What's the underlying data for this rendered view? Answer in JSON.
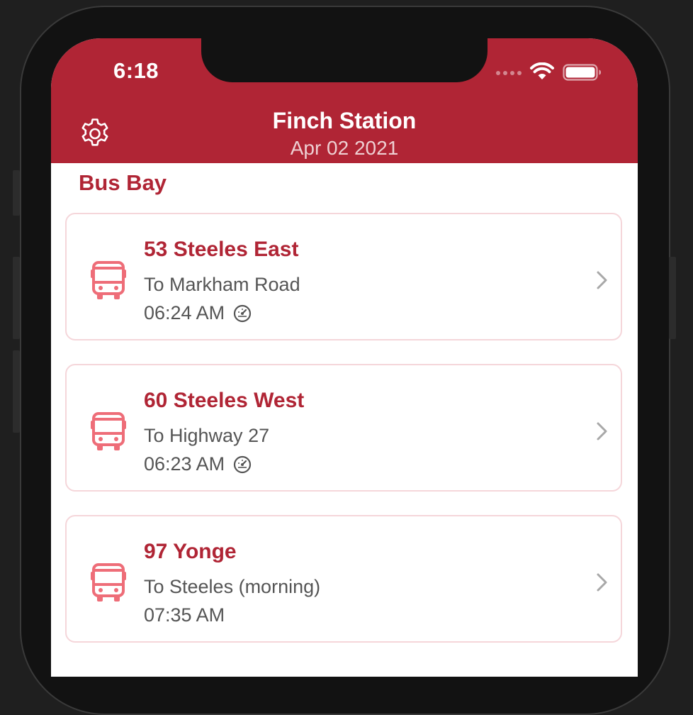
{
  "status_bar": {
    "time": "6:18"
  },
  "nav": {
    "title": "Finch Station",
    "subtitle": "Apr 02 2021",
    "settings_icon": "gear-icon"
  },
  "section": {
    "title": "Bus Bay"
  },
  "routes": [
    {
      "name": "53 Steeles East",
      "direction": "To Markham Road",
      "time": "06:24 AM",
      "realtime_icon": "speedometer-icon",
      "realtime": true
    },
    {
      "name": "60 Steeles West",
      "direction": "To Highway 27",
      "time": "06:23 AM",
      "realtime_icon": "speedometer-icon",
      "realtime": true
    },
    {
      "name": "97 Yonge",
      "direction": "To Steeles (morning)",
      "time": "07:35 AM",
      "realtime": false
    }
  ],
  "colors": {
    "brand": "#b02535",
    "bus_icon": "#ee6d78",
    "card_border": "#f5d6da",
    "secondary_text": "#555555"
  }
}
